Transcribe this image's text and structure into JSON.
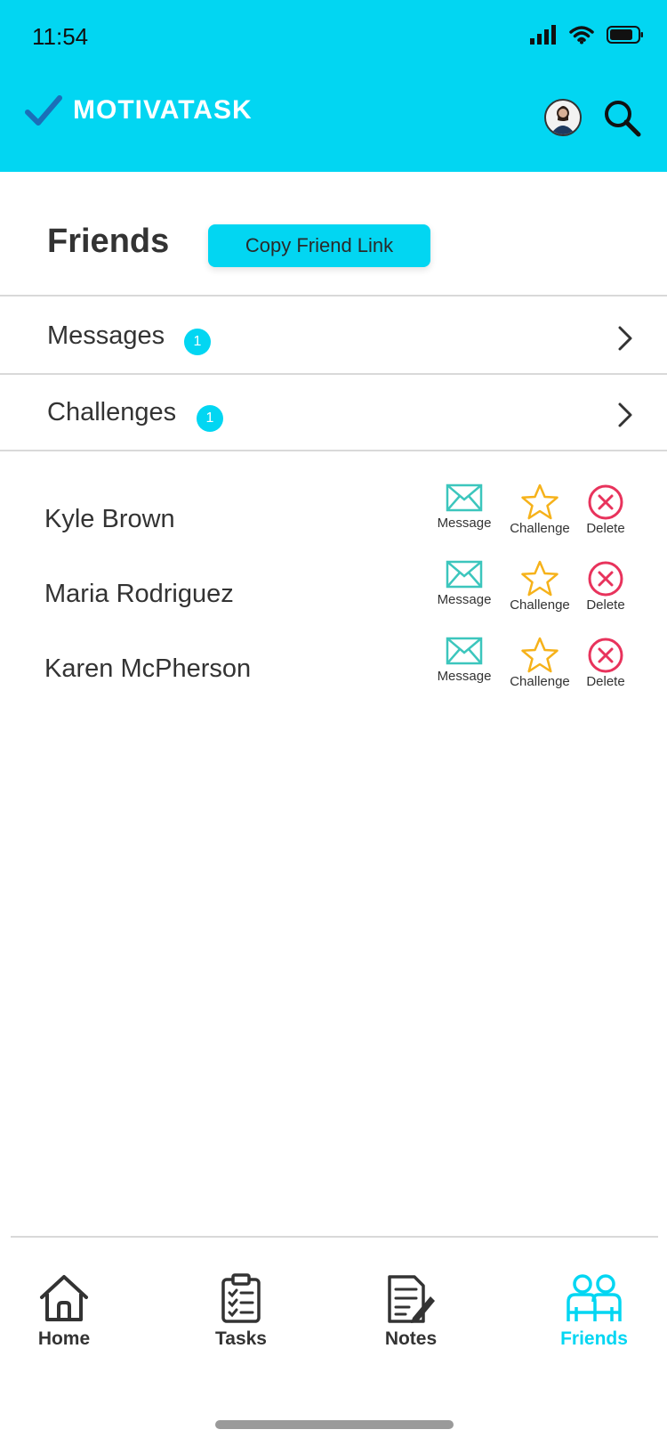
{
  "status_bar": {
    "time": "11:54"
  },
  "app": {
    "title": "MOTIVATASK"
  },
  "page": {
    "title": "Friends",
    "copy_link_label": "Copy Friend Link"
  },
  "sections": [
    {
      "label": "Messages",
      "badge": "1"
    },
    {
      "label": "Challenges",
      "badge": "1"
    }
  ],
  "friends": [
    {
      "name": "Kyle Brown"
    },
    {
      "name": "Maria Rodriguez"
    },
    {
      "name": "Karen McPherson"
    }
  ],
  "actions": {
    "message": "Message",
    "challenge": "Challenge",
    "delete": "Delete"
  },
  "tabs": [
    {
      "label": "Home",
      "icon": "home-icon"
    },
    {
      "label": "Tasks",
      "icon": "clipboard-icon"
    },
    {
      "label": "Notes",
      "icon": "notes-icon"
    },
    {
      "label": "Friends",
      "icon": "friends-icon",
      "active": true
    }
  ],
  "colors": {
    "accent": "#02d6f2",
    "message": "#3cc6bd",
    "challenge": "#f6b21a",
    "delete": "#e8335c",
    "text": "#333333"
  }
}
